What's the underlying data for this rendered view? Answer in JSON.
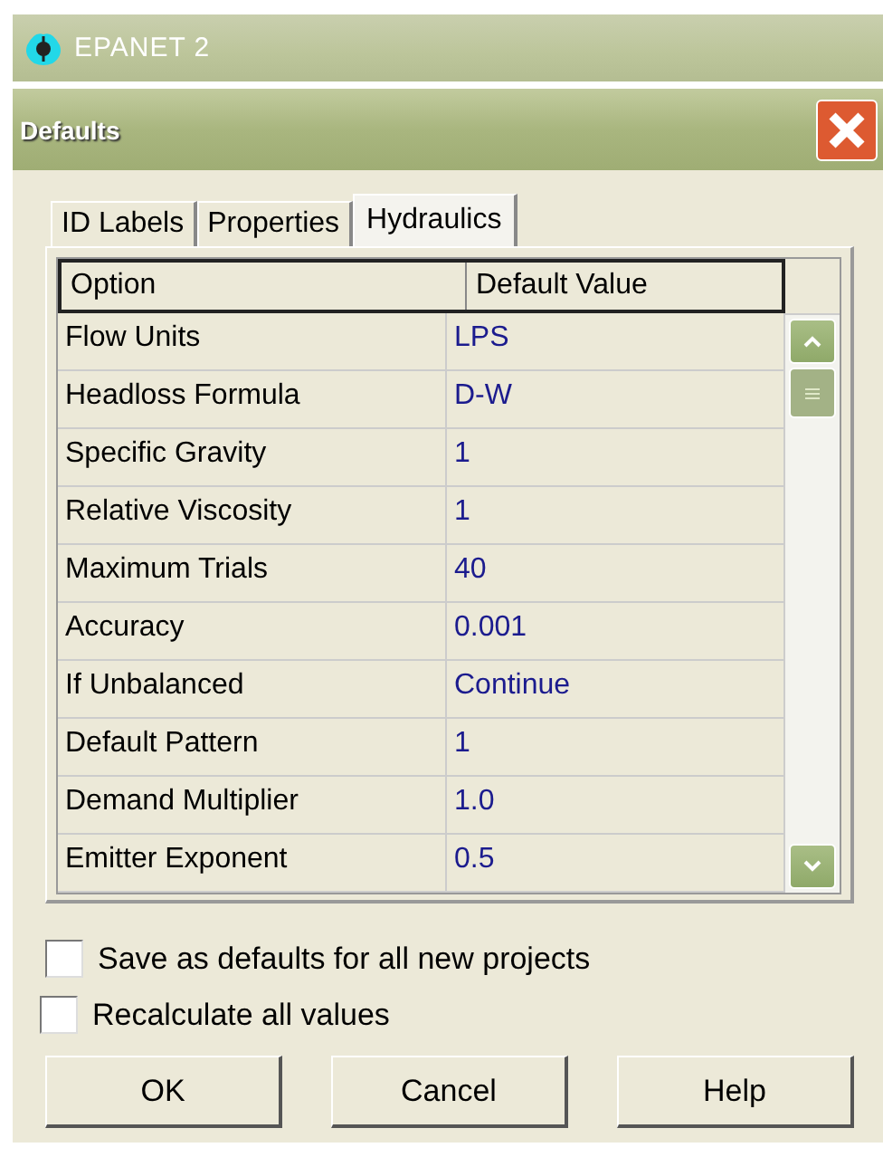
{
  "app_title_bar": {
    "title": "EPANET 2"
  },
  "dialog": {
    "title": "Defaults"
  },
  "tabs": [
    {
      "label": "ID Labels",
      "selected": false
    },
    {
      "label": "Properties",
      "selected": false
    },
    {
      "label": "Hydraulics",
      "selected": true
    }
  ],
  "table": {
    "columns": [
      "Option",
      "Default Value"
    ],
    "rows": [
      {
        "option": "Flow Units",
        "value": "LPS"
      },
      {
        "option": "Headloss Formula",
        "value": "D-W"
      },
      {
        "option": "Specific Gravity",
        "value": "1"
      },
      {
        "option": "Relative Viscosity",
        "value": "1"
      },
      {
        "option": "Maximum Trials",
        "value": "40"
      },
      {
        "option": "Accuracy",
        "value": "0.001"
      },
      {
        "option": "If Unbalanced",
        "value": "Continue"
      },
      {
        "option": "Default Pattern",
        "value": "1"
      },
      {
        "option": "Demand Multiplier",
        "value": "1.0"
      },
      {
        "option": "Emitter Exponent",
        "value": "0.5"
      }
    ]
  },
  "checkboxes": [
    {
      "label": "Save as defaults for all new projects",
      "checked": false
    },
    {
      "label": "Recalculate all values",
      "checked": false
    }
  ],
  "buttons": [
    "OK",
    "Cancel",
    "Help"
  ]
}
